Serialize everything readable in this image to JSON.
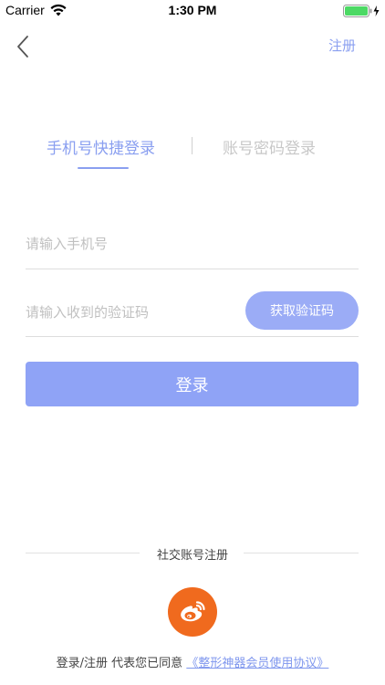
{
  "status_bar": {
    "carrier": "Carrier",
    "time": "1:30 PM",
    "battery_color": "#4cd964"
  },
  "nav": {
    "back_icon": "chevron-left-icon",
    "register_label": "注册"
  },
  "tabs": [
    {
      "label": "手机号快捷登录",
      "active": true
    },
    {
      "label": "账号密码登录",
      "active": false
    }
  ],
  "form": {
    "phone_placeholder": "请输入手机号",
    "phone_value": "",
    "code_placeholder": "请输入收到的验证码",
    "code_value": "",
    "get_code_label": "获取验证码",
    "login_label": "登录"
  },
  "social": {
    "label": "社交账号注册",
    "weibo_icon": "weibo-icon"
  },
  "agreement": {
    "text": "登录/注册 代表您已同意",
    "link": "《整形神器会员使用协议》"
  },
  "colors": {
    "accent": "#8a9ff0",
    "button": "#8fa3f6",
    "weibo": "#f06a1e"
  }
}
